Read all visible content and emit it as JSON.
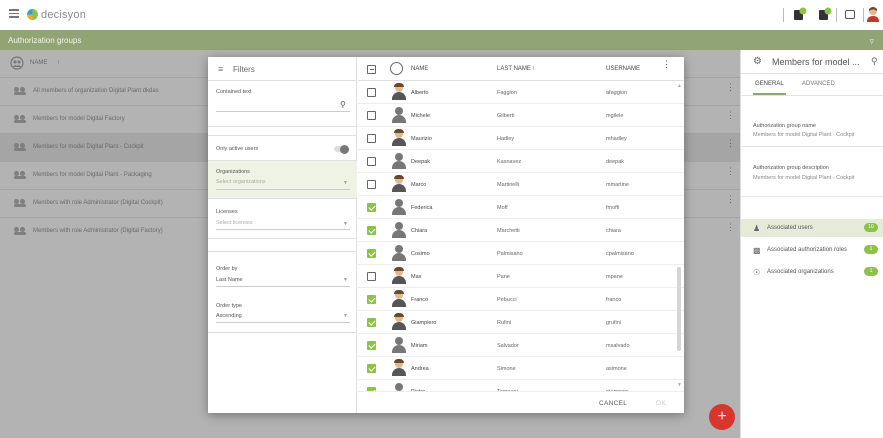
{
  "app": {
    "logo": "decisyon"
  },
  "page": {
    "title": "Authorization groups"
  },
  "list": {
    "header": "NAME",
    "rows": [
      "All members of organization Digital Plant dkdas",
      "Members for model Digital Factory",
      "Members for model Digital Plant - Cockpit",
      "Members for model Digital Plant - Packaging",
      "Members with role Administrator (Digital Cockpit)",
      "Members with role Administrator (Digital Factory)"
    ]
  },
  "filters": {
    "title": "Filters",
    "contained_text_label": "Contained text",
    "only_active_label": "Only active users",
    "organizations_label": "Organizations",
    "organizations_placeholder": "Select organizations",
    "licenses_label": "Licenses",
    "licenses_placeholder": "Select licenses",
    "order_by_label": "Order by",
    "order_by_value": "Last Name",
    "order_type_label": "Order type",
    "order_type_value": "Ascending"
  },
  "users": {
    "col_name": "NAME",
    "col_last": "LAST NAME",
    "col_user": "USERNAME",
    "rows": [
      {
        "first": "Alberto",
        "last": "Faggion",
        "user": "afaggion",
        "checked": false,
        "photo": true
      },
      {
        "first": "Michele",
        "last": "Gilberti",
        "user": "mgilele",
        "checked": false,
        "photo": false
      },
      {
        "first": "Maurizio",
        "last": "Hadley",
        "user": "mhadley",
        "checked": false,
        "photo": true
      },
      {
        "first": "Deepak",
        "last": "Kasnavez",
        "user": "deepak",
        "checked": false,
        "photo": false
      },
      {
        "first": "Marco",
        "last": "Martinelli",
        "user": "mmartine",
        "checked": false,
        "photo": true
      },
      {
        "first": "Federica",
        "last": "Moff",
        "user": "fmoffi",
        "checked": true,
        "photo": false
      },
      {
        "first": "Chiara",
        "last": "Marchetti",
        "user": "chiara",
        "checked": true,
        "photo": false
      },
      {
        "first": "Cosimo",
        "last": "Palmisano",
        "user": "cpalmisano",
        "checked": true,
        "photo": false
      },
      {
        "first": "Max",
        "last": "Pane",
        "user": "mpane",
        "checked": false,
        "photo": true
      },
      {
        "first": "Franco",
        "last": "Pebucci",
        "user": "franco",
        "checked": true,
        "photo": true
      },
      {
        "first": "Giampiero",
        "last": "Rufini",
        "user": "grufini",
        "checked": true,
        "photo": true
      },
      {
        "first": "Miriam",
        "last": "Salvador",
        "user": "msalvado",
        "checked": true,
        "photo": false
      },
      {
        "first": "Andrea",
        "last": "Simone",
        "user": "asimone",
        "checked": true,
        "photo": true
      },
      {
        "first": "Pietro",
        "last": "Tamponi",
        "user": "ptamponi",
        "checked": true,
        "photo": false
      }
    ],
    "cancel": "CANCEL",
    "ok": "OK"
  },
  "right_panel": {
    "title": "Members for model ...",
    "tab_general": "GENERAL",
    "tab_advanced": "ADVANCED",
    "name_label": "Authorization group name",
    "name_value": "Members for model Digital Plant - Cockpit",
    "desc_label": "Authorization group description",
    "desc_value": "Members for model Digital Plant - Cockpit",
    "items": [
      {
        "label": "Associated users",
        "count": "10"
      },
      {
        "label": "Associated authorization roles",
        "count": "1"
      },
      {
        "label": "Associated organizations",
        "count": "1"
      }
    ]
  },
  "fab_label": "+"
}
